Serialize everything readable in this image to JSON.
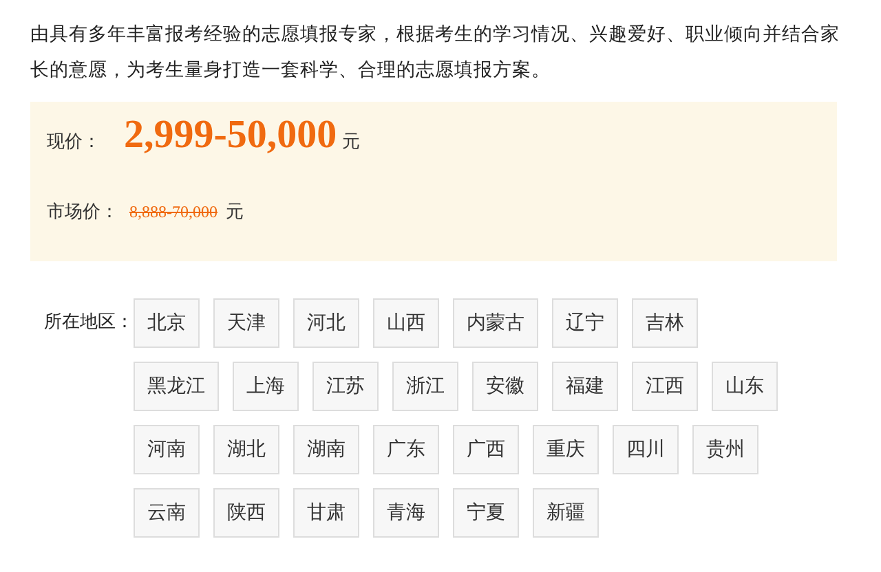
{
  "description": "由具有多年丰富报考经验的志愿填报专家，根据考生的学习情况、兴趣爱好、职业倾向并结合家长的意愿，为考生量身打造一套科学、合理的志愿填报方案。",
  "price": {
    "label": "现价：",
    "value": "2,999-50,000",
    "unit": "元"
  },
  "market_price": {
    "label": "市场价：",
    "value": "8,888-70,000",
    "unit": "元"
  },
  "region": {
    "label": "所在地区：",
    "options": [
      {
        "label": "北京"
      },
      {
        "label": "天津"
      },
      {
        "label": "河北"
      },
      {
        "label": "山西"
      },
      {
        "label": "内蒙古"
      },
      {
        "label": "辽宁"
      },
      {
        "label": "吉林"
      },
      {
        "label": "黑龙江"
      },
      {
        "label": "上海"
      },
      {
        "label": "江苏"
      },
      {
        "label": "浙江"
      },
      {
        "label": "安徽"
      },
      {
        "label": "福建"
      },
      {
        "label": "江西"
      },
      {
        "label": "山东"
      },
      {
        "label": "河南"
      },
      {
        "label": "湖北"
      },
      {
        "label": "湖南"
      },
      {
        "label": "广东"
      },
      {
        "label": "广西"
      },
      {
        "label": "重庆"
      },
      {
        "label": "四川"
      },
      {
        "label": "贵州"
      },
      {
        "label": "云南"
      },
      {
        "label": "陕西"
      },
      {
        "label": "甘肃"
      },
      {
        "label": "青海"
      },
      {
        "label": "宁夏"
      },
      {
        "label": "新疆"
      }
    ]
  }
}
